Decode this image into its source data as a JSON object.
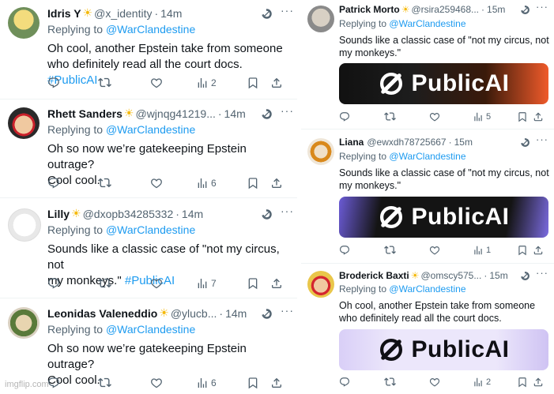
{
  "left_tweets": [
    {
      "name": "Idris Y",
      "handle": "@x_identity",
      "time": "14m",
      "replying_prefix": "Replying to",
      "replying_to": "@WarClandestine",
      "text_lines": [
        "Oh cool, another Epstein take from someone",
        "who definitely read all the court docs. "
      ],
      "hashtag": "#PublicAI",
      "views": "2"
    },
    {
      "name": "Rhett Sanders",
      "handle": "@wjnqg41219...",
      "time": "14m",
      "replying_prefix": "Replying to",
      "replying_to": "@WarClandestine",
      "text_lines": [
        "Oh so now we’re gatekeeping Epstein outrage?",
        "Cool cool."
      ],
      "hashtag": "",
      "views": "6"
    },
    {
      "name": "Lilly",
      "handle": "@dxopb34285332",
      "time": "14m",
      "replying_prefix": "Replying to",
      "replying_to": "@WarClandestine",
      "text_lines": [
        "Sounds like a classic case of \"not my circus, not",
        "my monkeys.\" "
      ],
      "hashtag": "#PublicAI",
      "views": "7"
    },
    {
      "name": "Leonidas Valeneddio",
      "handle": "@ylucb...",
      "time": "14m",
      "replying_prefix": "Replying to",
      "replying_to": "@WarClandestine",
      "text_lines": [
        "Oh so now we’re gatekeeping Epstein outrage?",
        "Cool cool."
      ],
      "hashtag": "",
      "views": "6"
    }
  ],
  "right_tweets": [
    {
      "name": "Patrick Morto",
      "handle": "@rsira259468...",
      "time": "15m",
      "replying_prefix": "Replying to",
      "replying_to": "@WarClandestine",
      "text_lines": [
        "Sounds like a classic case of \"not my circus, not",
        "my monkeys.\""
      ],
      "banner_text": "PublicAI",
      "views": "5"
    },
    {
      "name": "Liana",
      "handle": "@ewxdh78725667",
      "time": "15m",
      "replying_prefix": "Replying to",
      "replying_to": "@WarClandestine",
      "text_lines": [
        "Sounds like a classic case of \"not my circus, not",
        "my monkeys.\""
      ],
      "banner_text": "PublicAI",
      "views": "1"
    },
    {
      "name": "Broderick Baxti",
      "handle": "@omscy575...",
      "time": "15m",
      "replying_prefix": "Replying to",
      "replying_to": "@WarClandestine",
      "text_lines": [
        "Oh cool, another Epstein take from someone",
        "who definitely read all the court docs."
      ],
      "banner_text": "PublicAI",
      "views": "2"
    }
  ],
  "watermark": "imgflip.com",
  "colors": {
    "link": "#1d9bf0",
    "muted": "#536471",
    "text": "#0f1419",
    "sun": "#f5b90a"
  }
}
